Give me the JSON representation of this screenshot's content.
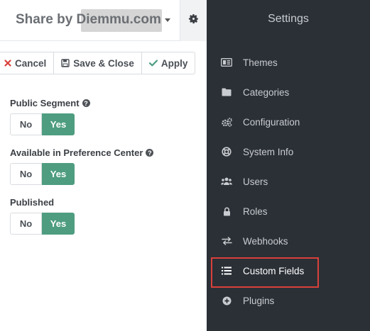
{
  "header": {
    "brand": "Share by Diemmu.com",
    "dropdown_icon": "caret-down-icon",
    "settings_icon": "gear-icon"
  },
  "toolbar": {
    "cancel_label": "Cancel",
    "save_close_label": "Save & Close",
    "apply_label": "Apply"
  },
  "form": {
    "public_segment": {
      "label": "Public Segment",
      "no": "No",
      "yes": "Yes",
      "selected": "Yes"
    },
    "preference_center": {
      "label": "Available in Preference Center",
      "no": "No",
      "yes": "Yes",
      "selected": "Yes"
    },
    "published": {
      "label": "Published",
      "no": "No",
      "yes": "Yes",
      "selected": "Yes"
    }
  },
  "settings": {
    "title": "Settings",
    "items": [
      {
        "label": "Themes",
        "icon": "themes-icon"
      },
      {
        "label": "Categories",
        "icon": "folder-icon"
      },
      {
        "label": "Configuration",
        "icon": "cogs-icon"
      },
      {
        "label": "System Info",
        "icon": "lifebuoy-icon"
      },
      {
        "label": "Users",
        "icon": "users-icon"
      },
      {
        "label": "Roles",
        "icon": "lock-icon"
      },
      {
        "label": "Webhooks",
        "icon": "exchange-icon"
      },
      {
        "label": "Custom Fields",
        "icon": "list-icon"
      },
      {
        "label": "Plugins",
        "icon": "plus-circle-icon"
      }
    ]
  },
  "colors": {
    "accent_green": "#4e9d80",
    "sidebar_bg": "#2b3037",
    "highlight_red": "#d9403a"
  }
}
